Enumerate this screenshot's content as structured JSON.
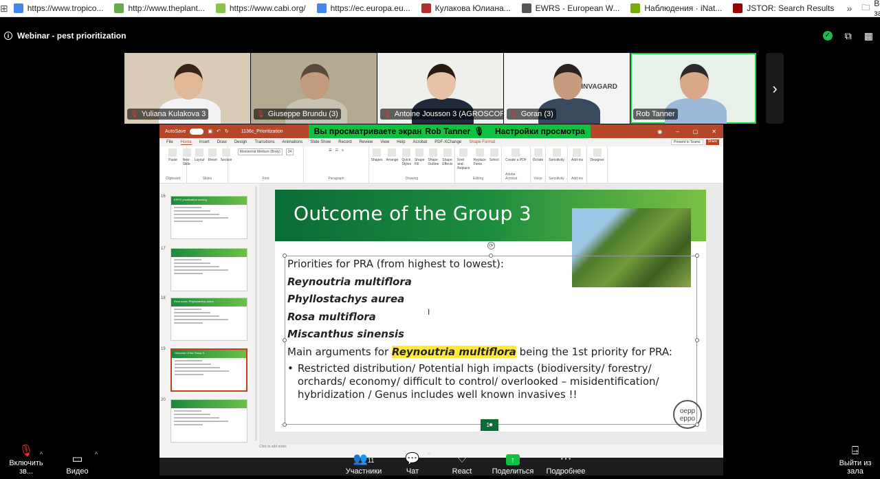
{
  "bookmarks": [
    {
      "label": "https://www.tropico...",
      "icon": "google-icon",
      "color": "#4285f4"
    },
    {
      "label": "http://www.theplant...",
      "icon": "leaf-icon",
      "color": "#6aa84f"
    },
    {
      "label": "https://www.cabi.org/",
      "icon": "cabi-icon",
      "color": "#8bc34a"
    },
    {
      "label": "https://ec.europa.eu...",
      "icon": "google-icon",
      "color": "#4285f4"
    },
    {
      "label": "Кулакова Юлиана...",
      "icon": "castle-icon",
      "color": "#b03030"
    },
    {
      "label": "EWRS - European W...",
      "icon": "globe-icon",
      "color": "#555555"
    },
    {
      "label": "Наблюдения · iNat...",
      "icon": "inat-icon",
      "color": "#74ac00"
    },
    {
      "label": "JSTOR: Search Results",
      "icon": "jstor-icon",
      "color": "#990000"
    }
  ],
  "bookmarks_all": "Все закладки",
  "meeting": {
    "title": "Webinar - pest prioritization"
  },
  "participants": [
    {
      "name": "Yuliana Kulakova 3",
      "bg": "#d9cbb5",
      "skin": "#e0b898",
      "hair": "#3a2418",
      "shirt": "#f2f2f2"
    },
    {
      "name": "Giuseppe Brundu (3)",
      "bg": "#b5aa8f",
      "skin": "#c29a7e",
      "hair": "#5a4a3a",
      "shirt": "#c8c2b0"
    },
    {
      "name": "Antoine Jousson 3 (AGROSCOPE)",
      "bg": "#eef0ec",
      "skin": "#e7c2a4",
      "hair": "#2a1a12",
      "shirt": "#202a3a"
    },
    {
      "name": "Goran (3)",
      "bg": "#f4f4f4",
      "skin": "#c79c7e",
      "hair": "#2a2220",
      "shirt": "#3a4a5e",
      "logo": "INVAGARD"
    },
    {
      "name": "Rob Tanner",
      "bg": "#e8f0ea",
      "skin": "#d9a88a",
      "hair": "#2a2a2a",
      "shirt": "#9bb8d8"
    }
  ],
  "share_banner": {
    "text": "Вы просматриваете экран",
    "presenter": "Rob Tanner",
    "options": "Настройки просмотра"
  },
  "ppt": {
    "autosave": "AutoSave",
    "toggle": "Off",
    "filename": "1136c_Prioritization",
    "menu": [
      "File",
      "Home",
      "Insert",
      "Draw",
      "Design",
      "Transitions",
      "Animations",
      "Slide Show",
      "Record",
      "Review",
      "View",
      "Help",
      "Acrobat",
      "PDF-XChange",
      "Shape Format"
    ],
    "present_teams": "Present in Teams",
    "share": "Share",
    "font": "Montserrat Medium (Body)",
    "font_size": "24",
    "ribbon_groups": [
      {
        "label": "Clipboard",
        "items": [
          "Paste"
        ]
      },
      {
        "label": "Slides",
        "items": [
          "New Slide",
          "Layout",
          "Reset",
          "Section"
        ]
      },
      {
        "label": "Font",
        "items": []
      },
      {
        "label": "Paragraph",
        "items": []
      },
      {
        "label": "Drawing",
        "items": [
          "Shapes",
          "Arrange",
          "Quick Styles",
          "Shape Fill",
          "Shape Outline",
          "Shape Effects"
        ]
      },
      {
        "label": "Editing",
        "items": [
          "Find and Replace",
          "Replace Fonts",
          "Select"
        ]
      },
      {
        "label": "Adobe Acrobat",
        "items": [
          "Create a PDF"
        ]
      },
      {
        "label": "Voice",
        "items": [
          "Dictate"
        ]
      },
      {
        "label": "Sensitivity",
        "items": [
          "Sensitivity"
        ]
      },
      {
        "label": "Add-ins",
        "items": [
          "Add-ins"
        ]
      },
      {
        "label": "",
        "items": [
          "Designer"
        ]
      }
    ],
    "thumbnails": [
      {
        "num": "16",
        "title": "EPPO prioritization scoring"
      },
      {
        "num": "17",
        "title": ""
      },
      {
        "num": "18",
        "title": "Final score: Phyllostachys aurea"
      },
      {
        "num": "19",
        "title": "Outcome of the Group 3"
      },
      {
        "num": "20",
        "title": ""
      }
    ],
    "notes": "Click to add notes"
  },
  "slide": {
    "title": "Outcome of the Group 3",
    "intro": "Priorities for PRA (from highest to lowest):",
    "species": [
      "Reynoutria multiflora",
      "Phyllostachys aurea",
      "Rosa multiflora",
      "Miscanthus sinensis"
    ],
    "args_prefix": "Main arguments for",
    "args_species": "Reynoutria multiflora",
    "args_suffix": "being the 1st priority for PRA:",
    "bullet_lines": [
      "Restricted distribution/ Potential high impacts (biodiversity/ forestry/",
      "orchards/ economy/ difficult to control/ overlooked – misidentification/",
      "hybridization / Genus includes well known invasives !!"
    ],
    "eppo_top": "oepp",
    "eppo_bottom": "eppo",
    "page": "10"
  },
  "controls": {
    "audio": "Включить зв...",
    "video": "Видео",
    "participants": "Участники",
    "participants_count": "11",
    "chat": "Чат",
    "react": "React",
    "share": "Поделиться",
    "more": "Подробнее",
    "leave": "Выйти из зала"
  }
}
